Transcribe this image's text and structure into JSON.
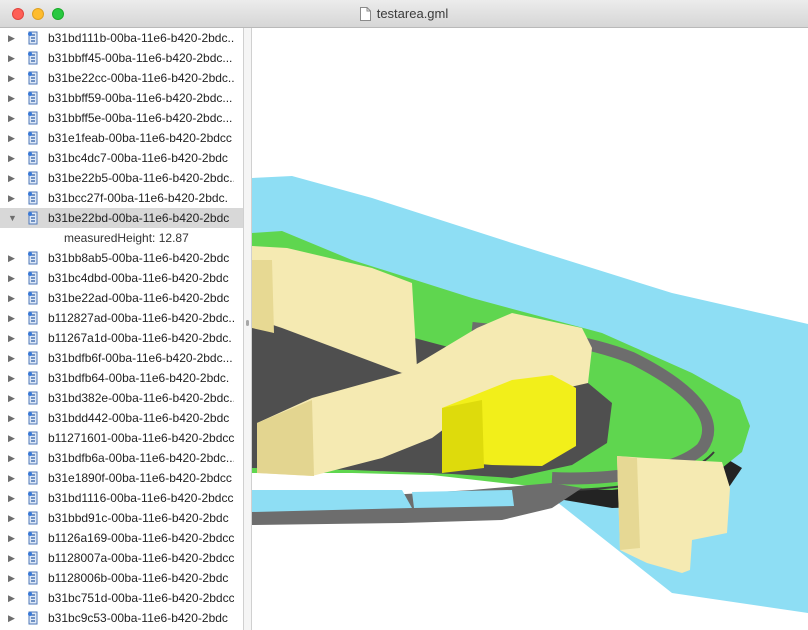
{
  "window": {
    "title": "testarea.gml"
  },
  "tree": {
    "rows": [
      {
        "label": "b31bd111b-00ba-11e6-b420-2bdc...",
        "expanded": false
      },
      {
        "label": "b31bbff45-00ba-11e6-b420-2bdc...",
        "expanded": false
      },
      {
        "label": "b31be22cc-00ba-11e6-b420-2bdc...",
        "expanded": false
      },
      {
        "label": "b31bbff59-00ba-11e6-b420-2bdc...",
        "expanded": false
      },
      {
        "label": "b31bbff5e-00ba-11e6-b420-2bdc...",
        "expanded": false
      },
      {
        "label": "b31e1feab-00ba-11e6-b420-2bdcc",
        "expanded": false
      },
      {
        "label": "b31bc4dc7-00ba-11e6-b420-2bdc",
        "expanded": false
      },
      {
        "label": "b31be22b5-00ba-11e6-b420-2bdc...",
        "expanded": false
      },
      {
        "label": "b31bcc27f-00ba-11e6-b420-2bdc.",
        "expanded": false
      },
      {
        "label": "b31be22bd-00ba-11e6-b420-2bdc",
        "expanded": true,
        "selected": true
      },
      {
        "label": "b31bb8ab5-00ba-11e6-b420-2bdc",
        "expanded": false
      },
      {
        "label": "b31bc4dbd-00ba-11e6-b420-2bdc",
        "expanded": false
      },
      {
        "label": "b31be22ad-00ba-11e6-b420-2bdc",
        "expanded": false
      },
      {
        "label": "b112827ad-00ba-11e6-b420-2bdc...",
        "expanded": false
      },
      {
        "label": "b11267a1d-00ba-11e6-b420-2bdc.",
        "expanded": false
      },
      {
        "label": "b31bdfb6f-00ba-11e6-b420-2bdc...",
        "expanded": false
      },
      {
        "label": "b31bdfb64-00ba-11e6-b420-2bdc.",
        "expanded": false
      },
      {
        "label": "b31bd382e-00ba-11e6-b420-2bdc...",
        "expanded": false
      },
      {
        "label": "b31bdd442-00ba-11e6-b420-2bdc",
        "expanded": false
      },
      {
        "label": "b11271601-00ba-11e6-b420-2bdcc",
        "expanded": false
      },
      {
        "label": "b31bdfb6a-00ba-11e6-b420-2bdc...",
        "expanded": false
      },
      {
        "label": "b31e1890f-00ba-11e6-b420-2bdcc",
        "expanded": false
      },
      {
        "label": "b31bd1116-00ba-11e6-b420-2bdcc",
        "expanded": false
      },
      {
        "label": "b31bbd91c-00ba-11e6-b420-2bdc",
        "expanded": false
      },
      {
        "label": "b1126a169-00ba-11e6-b420-2bdcc",
        "expanded": false
      },
      {
        "label": "b1128007a-00ba-11e6-b420-2bdcc",
        "expanded": false
      },
      {
        "label": "b1128006b-00ba-11e6-b420-2bdc",
        "expanded": false
      },
      {
        "label": "b31bc751d-00ba-11e6-b420-2bdcc",
        "expanded": false
      },
      {
        "label": "b31bc9c53-00ba-11e6-b420-2bdc",
        "expanded": false
      }
    ],
    "expanded_attribute": "measuredHeight: 12.87",
    "collapsed_glyph": "▶",
    "expanded_glyph": "▼"
  },
  "icons": {
    "node": "building-feature-icon",
    "document": "document-icon"
  },
  "colors": {
    "water": "#8edef4",
    "grass": "#5fd64f",
    "road": "#6d6d6d",
    "pavement": "#4f4f4f",
    "building": "#f5eab2",
    "building_selected": "#f2ef1a",
    "selection_row": "#d8d8d8"
  }
}
